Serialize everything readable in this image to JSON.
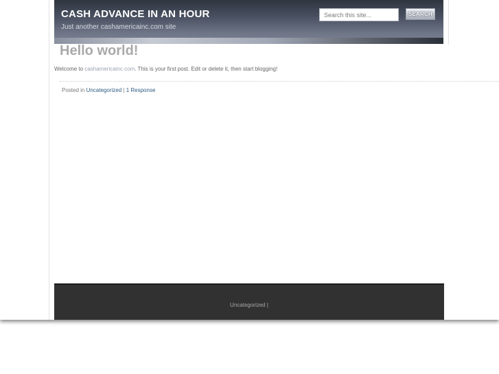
{
  "header": {
    "site_title": "CASH ADVANCE IN AN HOUR",
    "tagline": "Just another cashamericainc.com site",
    "search": {
      "placeholder": "Search this site...",
      "button_label": "SEARCH"
    }
  },
  "post": {
    "title": "Hello world!",
    "body_prefix": "Welcome to ",
    "body_link": "cashamericainc.com",
    "body_suffix": ". This is your first post. Edit or delete it, then start blogging!",
    "meta": {
      "posted_in_label": "Posted in ",
      "category": "Uncategorized",
      "separator": " | ",
      "responses": "1 Response"
    }
  },
  "footer": {
    "category": "Uncategorized",
    "separator": " |"
  },
  "colors": {
    "header_dark": "#2f353f",
    "header_light": "#7a8294",
    "title_gray": "#a9a9a9",
    "link_blue": "#2f5c82",
    "footer_bg": "#313131"
  }
}
